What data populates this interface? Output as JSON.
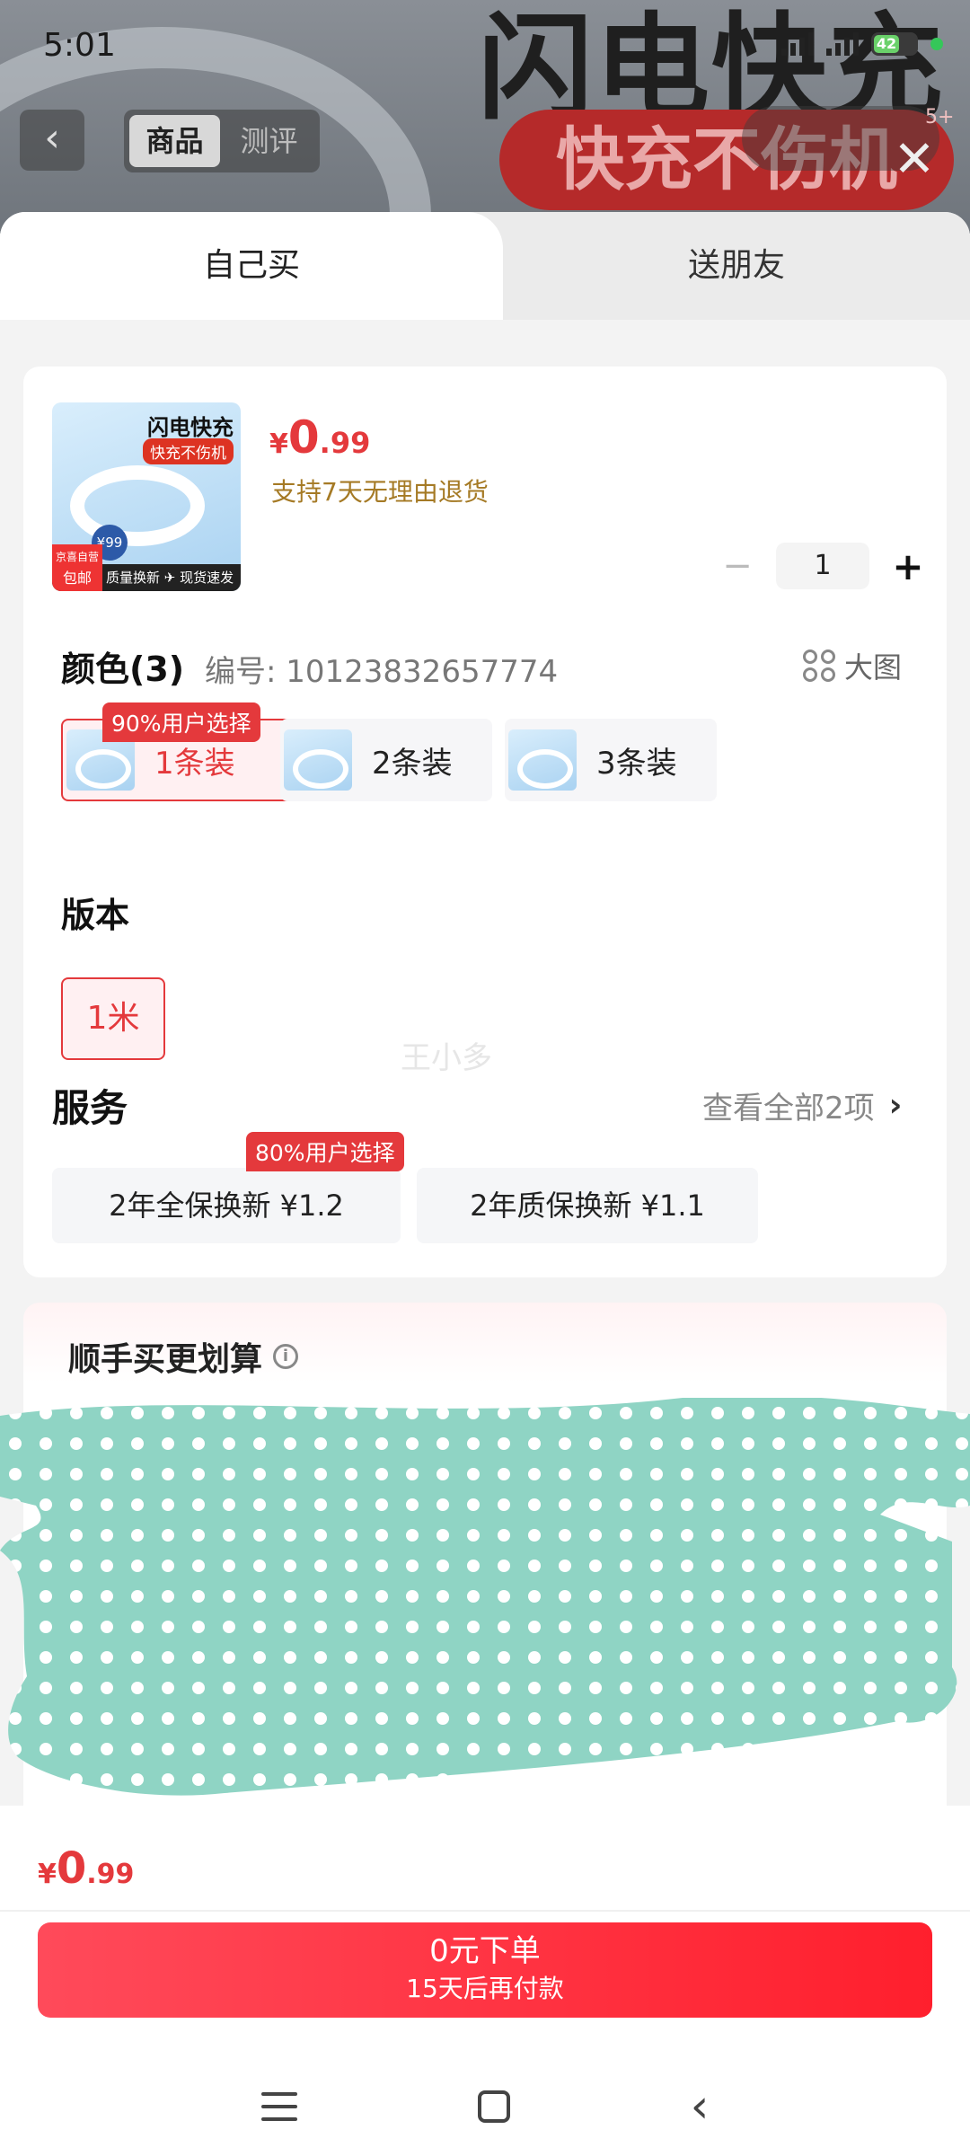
{
  "status_bar": {
    "time": "5:01",
    "battery": "42"
  },
  "background": {
    "title": "闪电快充",
    "banner": "快充不伤机",
    "tabs": [
      "商品",
      "测评"
    ],
    "active_tab": "商品",
    "badge": "5+"
  },
  "sheet": {
    "tabs": {
      "self": "自己买",
      "friend": "送朋友"
    },
    "product": {
      "thumb_title": "闪电快充",
      "thumb_sub": "快充不伤机",
      "thumb_tag_line1": "京喜自营",
      "thumb_tag_line2": "包邮",
      "thumb_footer": "质量换新 ✈ 现货速发",
      "thumb_price_badge": "¥99",
      "price_currency": "¥",
      "price_int": "0",
      "price_dec": ".99",
      "return_note": "支持7天无理由退货",
      "quantity": "1",
      "minus": "−",
      "plus": "+"
    },
    "color": {
      "label": "颜色(3)",
      "code": "编号: 10123832657774",
      "big_image": "大图",
      "options": [
        "1条装",
        "2条装",
        "3条装"
      ],
      "selected_index": 0,
      "popular_badge": "90%用户选择"
    },
    "version": {
      "label": "版本",
      "options": [
        "1米"
      ],
      "selected_index": 0
    },
    "watermark": "王小多",
    "service": {
      "label": "服务",
      "see_all": "查看全部2项",
      "options": [
        "2年全保换新  ¥1.2",
        "2年质保换新  ¥1.1"
      ],
      "popular_badge": "80%用户选择"
    },
    "bundle": {
      "title": "顺手买更划算"
    }
  },
  "bottom": {
    "total_currency": "¥",
    "total_int": "0",
    "total_dec": ".99",
    "order_line1": "0元下单",
    "order_line2": "15天后再付款"
  },
  "colors": {
    "accent": "#e4393c",
    "scribble": "#8fd4c4"
  }
}
